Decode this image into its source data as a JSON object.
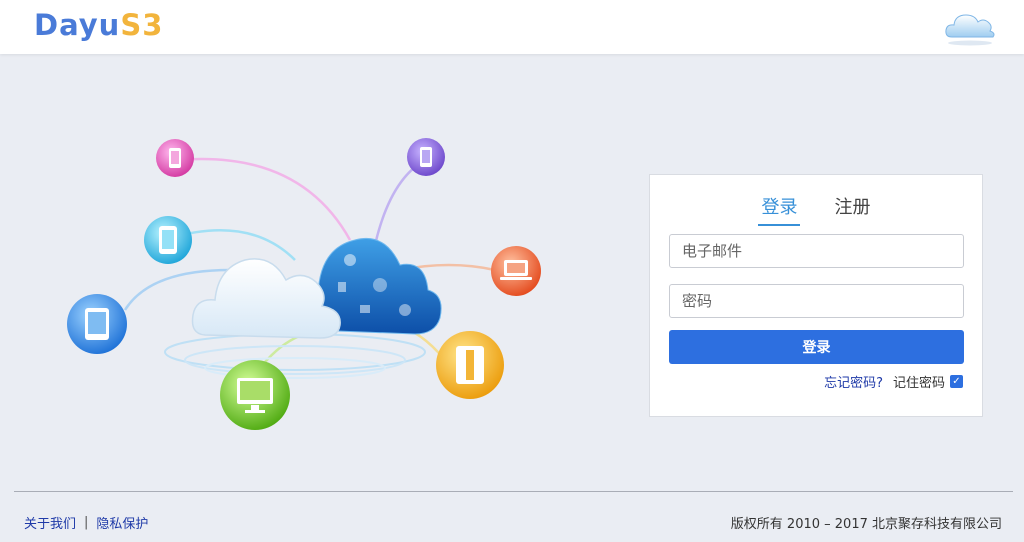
{
  "header": {
    "logo_part1": "Dayu",
    "logo_part2": "S3",
    "cloud_icon": "cloud-icon"
  },
  "hero": {
    "icons": [
      "smartphone-icon",
      "smartphone-icon",
      "tablet-icon",
      "tablet-icon",
      "laptop-icon",
      "monitor-icon",
      "book-icon",
      "cloud-icon"
    ]
  },
  "login": {
    "tabs": [
      {
        "label": "登录",
        "active": true
      },
      {
        "label": "注册",
        "active": false
      }
    ],
    "email_placeholder": "电子邮件",
    "email_value": "",
    "password_placeholder": "密码",
    "password_value": "",
    "submit_label": "登录",
    "forgot_label": "忘记密码?",
    "remember_label": "记住密码",
    "remember_checked": true
  },
  "footer": {
    "about_label": "关于我们",
    "separator": "|",
    "privacy_label": "隐私保护",
    "copyright": "版权所有 2010 – 2017 北京聚存科技有限公司"
  },
  "colors": {
    "accent": "#2d6fe0",
    "tab_active": "#3790d8",
    "logo_blue": "#4a7bd8",
    "logo_orange": "#f2b43c",
    "link": "#1f3aa8"
  }
}
